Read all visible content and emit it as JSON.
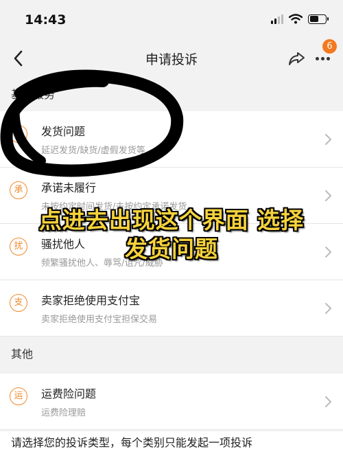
{
  "status_bar": {
    "time": "14:43"
  },
  "nav": {
    "title": "申请投诉",
    "badge_count": "6"
  },
  "sections": [
    {
      "header": "基础服务"
    },
    {
      "header": "其他"
    }
  ],
  "items": [
    {
      "icon_char": "运",
      "title": "发货问题",
      "subtitle": "延迟发货/缺货/虚假发货等"
    },
    {
      "icon_char": "承",
      "title": "承诺未履行",
      "subtitle": "未按约定时间发货/未按约定承诺发货"
    },
    {
      "icon_char": "扰",
      "title": "骚扰他人",
      "subtitle": "频繁骚扰他人、辱骂/诅咒/威胁"
    },
    {
      "icon_char": "支",
      "title": "卖家拒绝使用支付宝",
      "subtitle": "卖家拒绝使用支付宝担保交易"
    },
    {
      "icon_char": "运",
      "title": "运费险问题",
      "subtitle": "运费险理赔"
    }
  ],
  "footer": {
    "note": "请选择您的投诉类型，每个类别只能发起一项投诉"
  },
  "overlay": {
    "line1": "点进去出现这个界面 选择",
    "line2": "发货问题"
  },
  "colors": {
    "accent": "#f08a2c",
    "badge": "#f4791f",
    "caption": "#f6d23c"
  }
}
